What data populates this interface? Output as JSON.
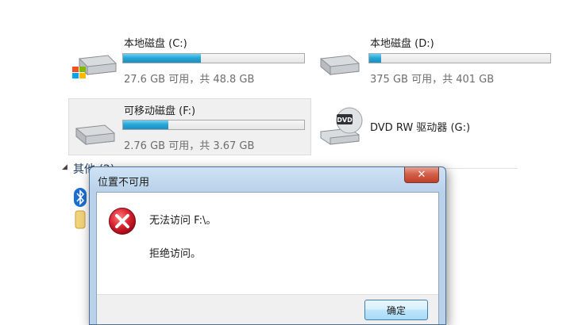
{
  "drives": [
    {
      "name": "本地磁盘 (C:)",
      "info": "27.6 GB 可用，共 48.8 GB",
      "used_fraction": 0.43
    },
    {
      "name": "本地磁盘 (D:)",
      "info": "375 GB 可用，共 401 GB",
      "used_fraction": 0.065
    },
    {
      "name": "可移动磁盘 (F:)",
      "info": "2.76 GB 可用，共 3.67 GB",
      "used_fraction": 0.25
    },
    {
      "name": "DVD RW 驱动器 (G:)"
    }
  ],
  "section": {
    "title": "其他 (2)"
  },
  "dialog": {
    "title": "位置不可用",
    "close_label": "✕",
    "message_line1": "无法访问 F:\\。",
    "message_line2": "拒绝访问。",
    "ok_label": "确定"
  },
  "colors": {
    "bar_fill": "#27a7d7",
    "close_button": "#c0402a",
    "error_red": "#c8102e"
  }
}
